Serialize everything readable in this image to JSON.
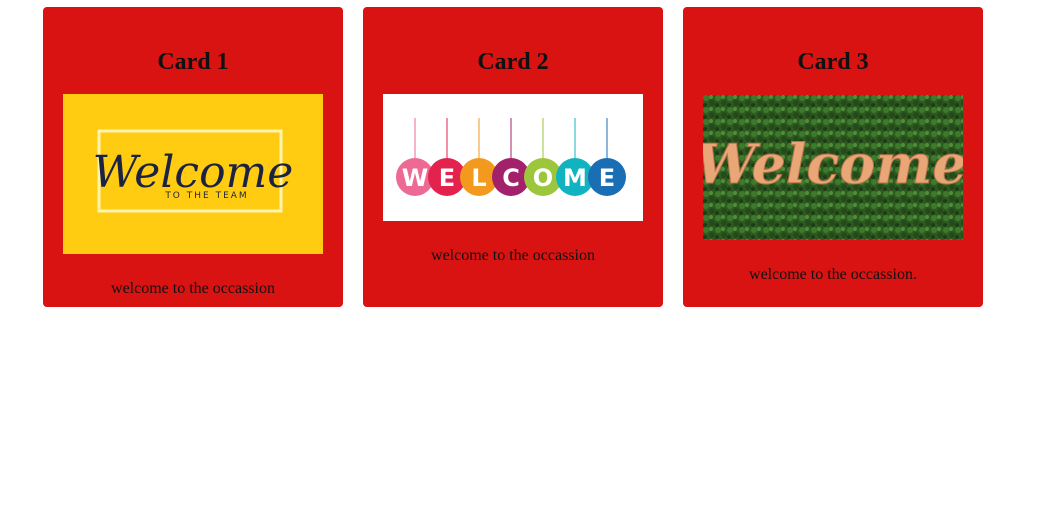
{
  "cards": [
    {
      "title": "Card 1",
      "image": {
        "description_icon": "welcome-to-the-team-image",
        "headline": "Welcome",
        "subline": "TO THE TEAM",
        "background": "#ffcc12"
      },
      "caption": "welcome to the occassion"
    },
    {
      "title": "Card 2",
      "image": {
        "description_icon": "welcome-hanging-circles-image",
        "letters": [
          "W",
          "E",
          "L",
          "C",
          "O",
          "M",
          "E"
        ],
        "letter_colors": [
          "#ec6a93",
          "#e3224d",
          "#f39a1e",
          "#a3206a",
          "#9cc63b",
          "#12b3c0",
          "#1a6fb4"
        ]
      },
      "caption": "welcome to the occassion"
    },
    {
      "title": "Card 3",
      "image": {
        "description_icon": "welcome-grass-wall-image",
        "headline": "Welcome",
        "background": "#2f5a22"
      },
      "caption": "welcome to the occassion."
    }
  ],
  "colors": {
    "card_background": "#d91212",
    "page_background": "#ffffff"
  }
}
